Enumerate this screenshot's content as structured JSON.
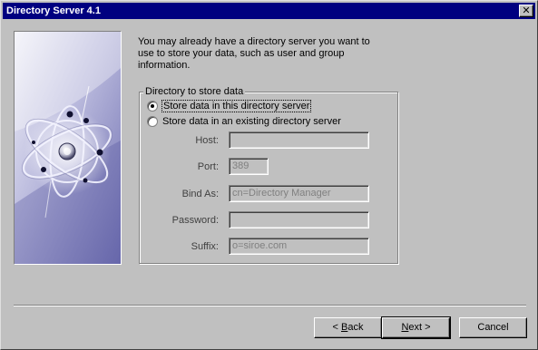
{
  "window": {
    "title": "Directory Server 4.1",
    "close_glyph": "✕"
  },
  "intro": {
    "text": "You may already have a directory server you want to\nuse to store your data, such as user and group\ninformation."
  },
  "group": {
    "label": "Directory to store data",
    "options": [
      {
        "label": "Store data in this directory server",
        "checked": true
      },
      {
        "label": "Store data in an existing directory server",
        "checked": false
      }
    ],
    "fields": [
      {
        "label": "Host:",
        "value": ""
      },
      {
        "label": "Port:",
        "value": "389"
      },
      {
        "label": "Bind As:",
        "value": "cn=Directory Manager"
      },
      {
        "label": "Password:",
        "value": ""
      },
      {
        "label": "Suffix:",
        "value": "o=siroe.com"
      }
    ]
  },
  "buttons": {
    "back": {
      "label": "< Back",
      "mnemonic_prefix": "< ",
      "mnemonic": "B",
      "rest": "ack"
    },
    "next": {
      "label": "Next >",
      "mnemonic": "N",
      "rest": "ext >"
    },
    "cancel": {
      "label": "Cancel"
    }
  },
  "colors": {
    "titlebar": "#000080",
    "face": "#c0c0c0",
    "panel_gradient_top": "#e6e6f2",
    "panel_gradient_bottom": "#7a7ab8"
  }
}
